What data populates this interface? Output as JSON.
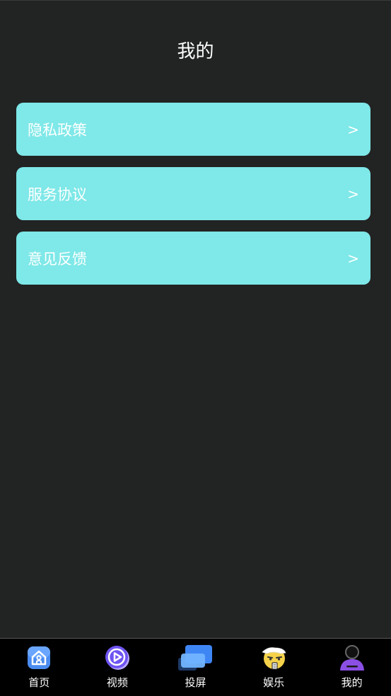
{
  "header": {
    "title": "我的"
  },
  "menu": {
    "items": [
      {
        "label": "隐私政策",
        "arrow": ">"
      },
      {
        "label": "服务协议",
        "arrow": ">"
      },
      {
        "label": "意见反馈",
        "arrow": ">"
      }
    ]
  },
  "tabbar": {
    "tabs": [
      {
        "label": "首页",
        "icon": "home-icon"
      },
      {
        "label": "视频",
        "icon": "play-video-icon"
      },
      {
        "label": "投屏",
        "icon": "screen-cast-icon"
      },
      {
        "label": "娱乐",
        "icon": "emoji-face-icon"
      },
      {
        "label": "我的",
        "icon": "user-profile-icon"
      }
    ]
  },
  "colors": {
    "background": "#222323",
    "menu_item": "#7fe8e8",
    "tabbar": "#000000",
    "text": "#ffffff"
  }
}
